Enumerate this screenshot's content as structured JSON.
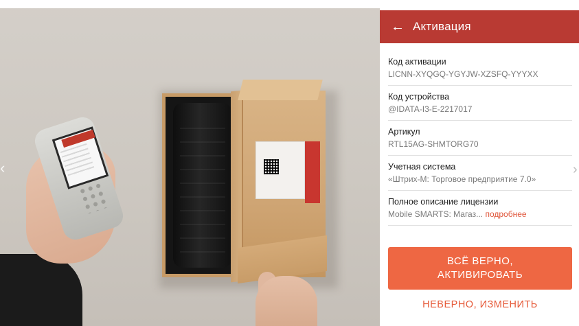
{
  "appbar": {
    "back_icon": "arrow-left-icon",
    "title": "Активация",
    "color": "#b93a33"
  },
  "fields": [
    {
      "label": "Код активации",
      "value": "LICNN-XYQGQ-YGYJW-XZSFQ-YYYXX"
    },
    {
      "label": "Код устройства",
      "value": "@IDATA-I3-E-2217017"
    },
    {
      "label": "Артикул",
      "value": "RTL15AG-SHMTORG70"
    },
    {
      "label": "Учетная система",
      "value": "«Штрих-М: Торговое предприятие 7.0»"
    },
    {
      "label": "Полное описание лицензии",
      "value": "Mobile SMARTS: Магаз...",
      "more_link": "подробнее"
    }
  ],
  "actions": {
    "confirm_label": "ВСЁ ВЕРНО, АКТИВИРОВАТЬ",
    "change_label": "НЕВЕРНО, ИЗМЕНИТЬ",
    "accent_color": "#ee6743"
  },
  "photo": {
    "left_nav_icon": "chevron-left-icon",
    "right_nav_icon": "chevron-right-icon"
  }
}
